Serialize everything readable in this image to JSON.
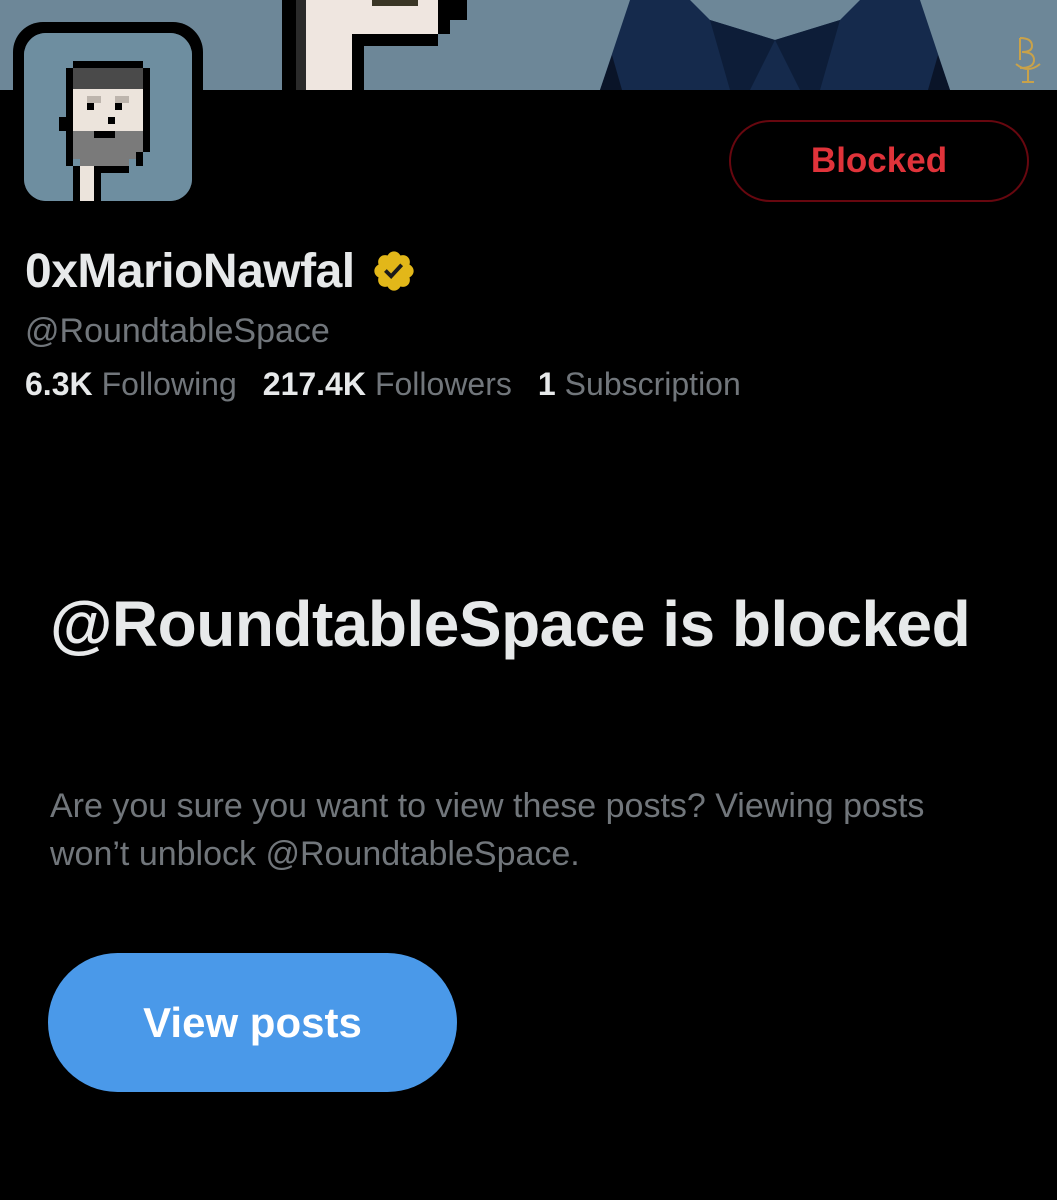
{
  "profile": {
    "display_name": "0xMarioNawfal",
    "handle": "@RoundtableSpace",
    "verified_icon": "verified-gold-badge",
    "stats": {
      "following_count": "6.3K",
      "following_label": "Following",
      "followers_count": "217.4K",
      "followers_label": "Followers",
      "subscription_count": "1",
      "subscription_label": "Subscription"
    }
  },
  "actions": {
    "blocked_label": "Blocked",
    "view_posts_label": "View posts"
  },
  "blocked_notice": {
    "title": "@RoundtableSpace is blocked",
    "description": "Are you sure you want to view these posts? Viewing posts won’t unblock @RoundtableSpace."
  },
  "colors": {
    "background": "#000000",
    "primary_text": "#e7e9ea",
    "secondary_text": "#71767b",
    "blocked_red": "#e0333a",
    "blocked_border": "#67070f",
    "accent_blue": "#4a99e9",
    "verified_gold": "#e2b719",
    "banner_bg": "#6d8798"
  }
}
